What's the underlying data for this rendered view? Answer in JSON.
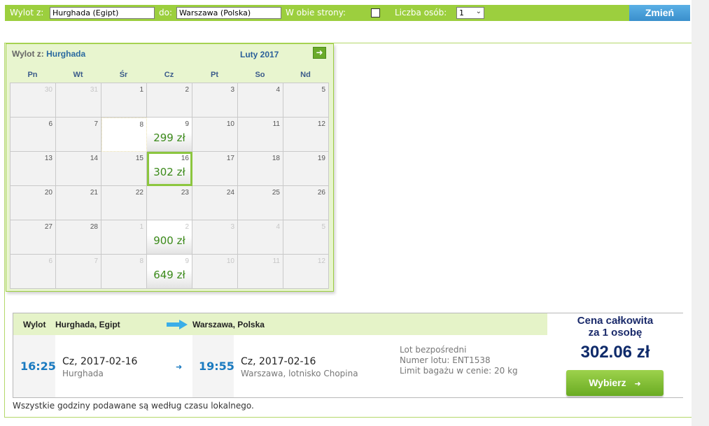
{
  "search": {
    "from_label": "Wylot z:",
    "from_value": "Hurghada (Egipt)",
    "to_label": "do:",
    "to_value": "Warszawa (Polska)",
    "roundtrip_label": "W obie strony:",
    "roundtrip_checked": false,
    "persons_label": "Liczba osób:",
    "persons_value": "1",
    "change_button": "Zmień"
  },
  "calendar": {
    "departure_label": "Wylot z:",
    "departure_city": "Hurghada",
    "month_label": "Luty 2017",
    "next_icon": "arrow-right-icon",
    "weekdays": [
      "Pn",
      "Wt",
      "Śr",
      "Cz",
      "Pt",
      "So",
      "Nd"
    ],
    "days": [
      {
        "num": "30",
        "dim": true
      },
      {
        "num": "31",
        "dim": true
      },
      {
        "num": "1"
      },
      {
        "num": "2"
      },
      {
        "num": "3"
      },
      {
        "num": "4"
      },
      {
        "num": "5"
      },
      {
        "num": "6"
      },
      {
        "num": "7"
      },
      {
        "num": "8",
        "today": true
      },
      {
        "num": "9",
        "price": "299 zł"
      },
      {
        "num": "10"
      },
      {
        "num": "11"
      },
      {
        "num": "12"
      },
      {
        "num": "13"
      },
      {
        "num": "14"
      },
      {
        "num": "15"
      },
      {
        "num": "16",
        "price": "302 zł",
        "selected": true
      },
      {
        "num": "17"
      },
      {
        "num": "18"
      },
      {
        "num": "19"
      },
      {
        "num": "20"
      },
      {
        "num": "21"
      },
      {
        "num": "22"
      },
      {
        "num": "23"
      },
      {
        "num": "24"
      },
      {
        "num": "25"
      },
      {
        "num": "26"
      },
      {
        "num": "27"
      },
      {
        "num": "28"
      },
      {
        "num": "1",
        "dim": true
      },
      {
        "num": "2",
        "dim": true,
        "price": "900 zł"
      },
      {
        "num": "3",
        "dim": true
      },
      {
        "num": "4",
        "dim": true
      },
      {
        "num": "5",
        "dim": true
      },
      {
        "num": "6",
        "dim": true
      },
      {
        "num": "7",
        "dim": true
      },
      {
        "num": "8",
        "dim": true
      },
      {
        "num": "9",
        "dim": true,
        "price": "649 zł"
      },
      {
        "num": "10",
        "dim": true
      },
      {
        "num": "11",
        "dim": true
      },
      {
        "num": "12",
        "dim": true
      }
    ]
  },
  "flight": {
    "direction_label": "Wylot",
    "origin": "Hurghada, Egipt",
    "destination": "Warszawa, Polska",
    "dep_time": "16:25",
    "dep_date": "Cz, 2017-02-16",
    "dep_place": "Hurghada",
    "arr_time": "19:55",
    "arr_date": "Cz, 2017-02-16",
    "arr_place": "Warszawa, lotnisko Chopina",
    "info": [
      "Lot bezpośredni",
      "Numer lotu: ENT1538",
      "Limit bagażu w cenie: 20 kg"
    ],
    "total_caption_1": "Cena całkowita",
    "total_caption_2": "za 1 osobę",
    "total_amount": "302.06 zł",
    "choose_button": "Wybierz"
  },
  "footer_note": "Wszystkie godziny podawane są według czasu lokalnego.",
  "colors": {
    "accent_green": "#9ccf3e",
    "button_blue": "#3a8fcc",
    "price_green": "#3b8a1a",
    "time_blue": "#1a7ac0"
  }
}
